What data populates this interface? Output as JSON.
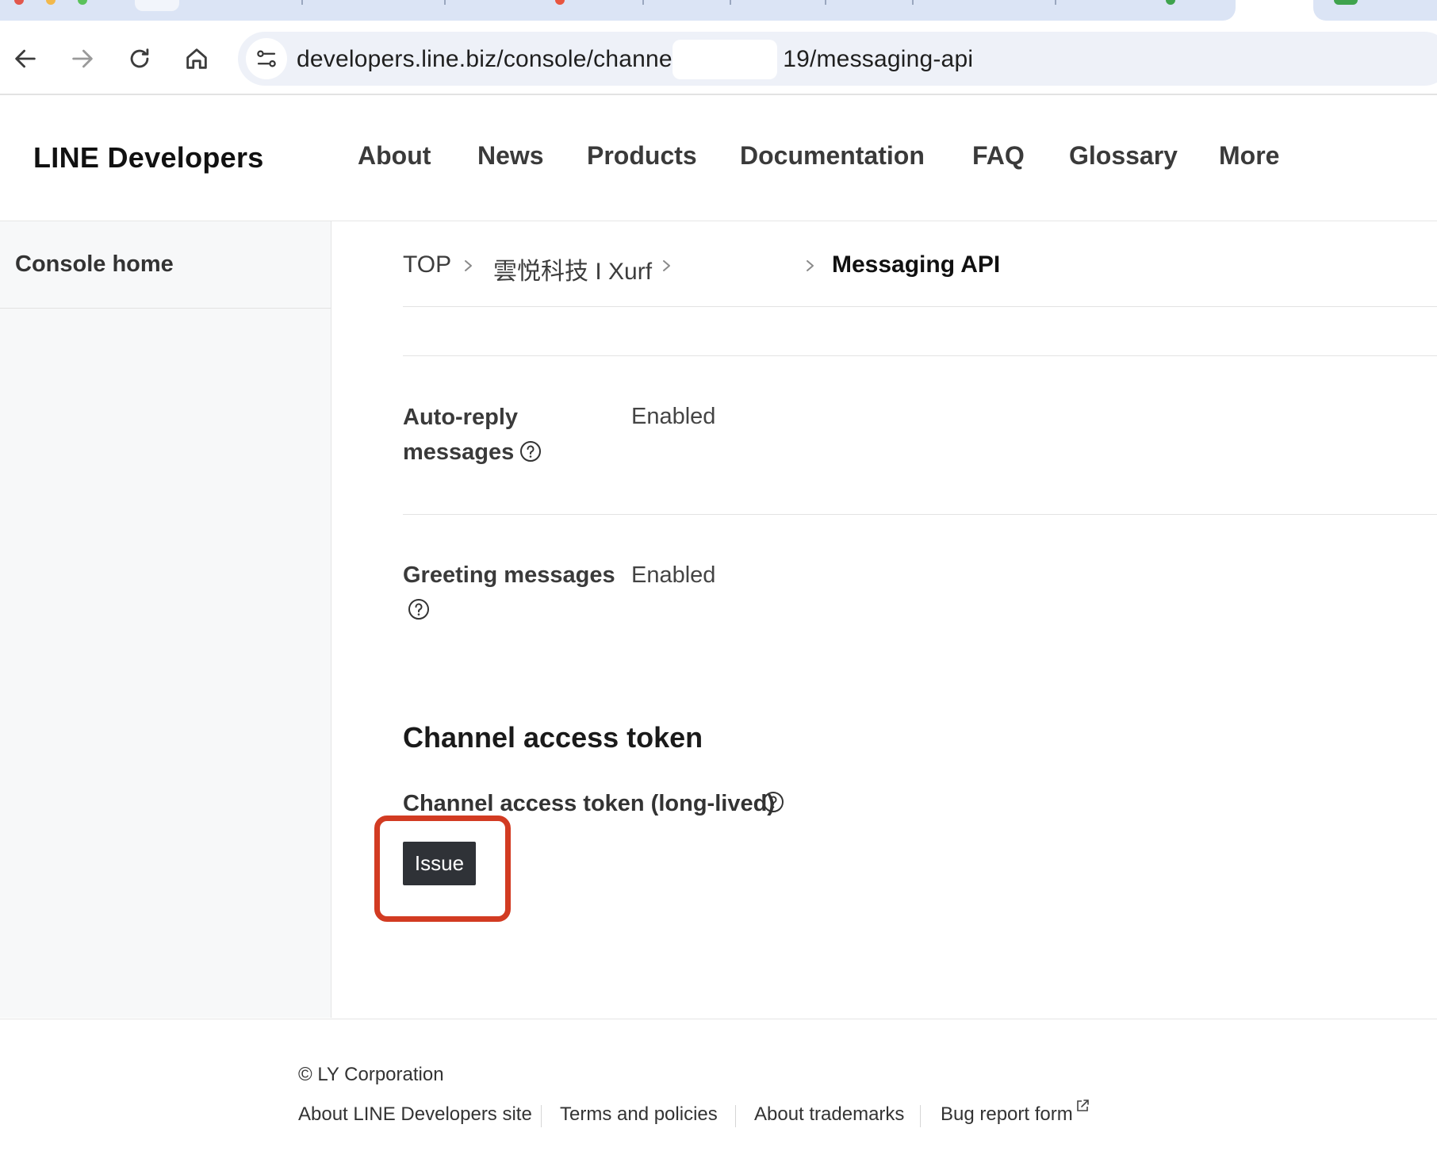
{
  "browser": {
    "url": "developers.line.biz/console/channel/",
    "url_suffix": "19/messaging-api"
  },
  "header": {
    "logo": "LINE Developers",
    "nav": [
      "About",
      "News",
      "Products",
      "Documentation",
      "FAQ",
      "Glossary",
      "More"
    ]
  },
  "sidebar": {
    "items": [
      {
        "label": "Console home"
      }
    ]
  },
  "breadcrumb": {
    "items": [
      "TOP",
      "雲悦科技 I Xurf",
      "",
      "Messaging API"
    ]
  },
  "settings": [
    {
      "label_line1": "Auto-reply",
      "label_line2": "messages",
      "value": "Enabled"
    },
    {
      "label_line1": "Greeting messages",
      "label_line2": "",
      "value": "Enabled"
    }
  ],
  "token_section": {
    "title": "Channel access token",
    "field_label": "Channel access token (long-lived)",
    "button_label": "Issue"
  },
  "footer": {
    "copyright": "© LY Corporation",
    "links": [
      "About LINE Developers site",
      "Terms and policies",
      "About trademarks",
      "Bug report form"
    ]
  },
  "colors": {
    "highlight": "#d23b22",
    "button_bg": "#2f3237",
    "omnibox_bg": "#eef1f8"
  }
}
